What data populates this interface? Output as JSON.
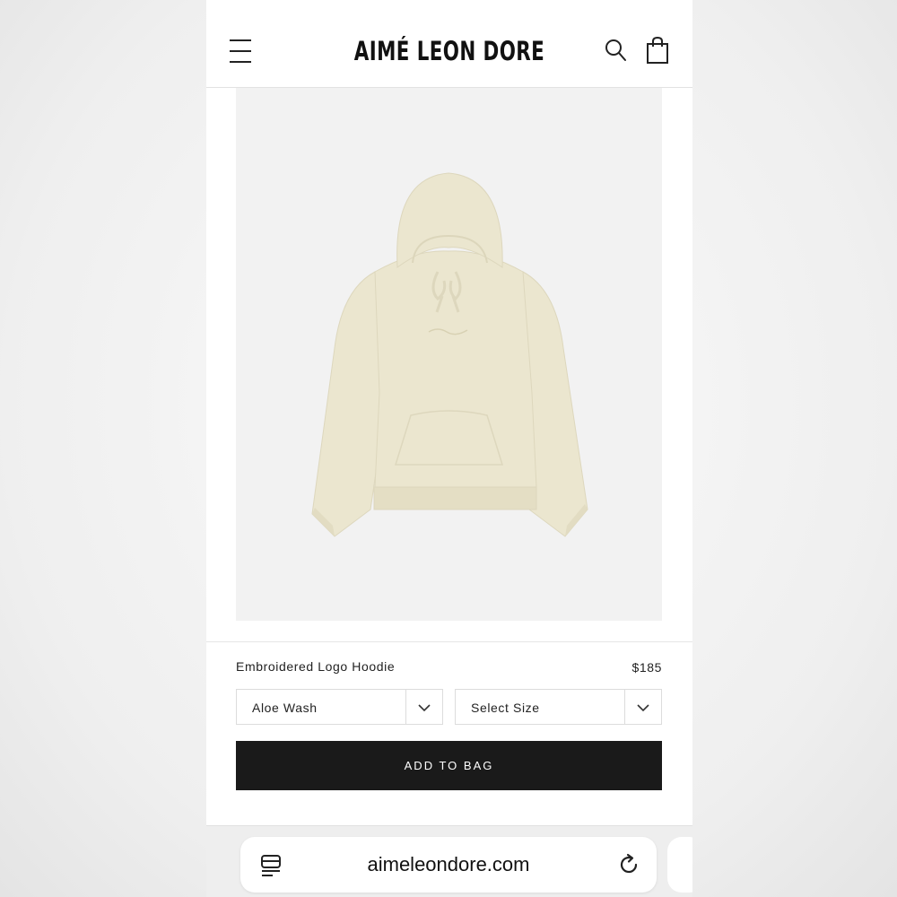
{
  "header": {
    "brand": "AIMÉ LEON DORE"
  },
  "product": {
    "name": "Embroidered Logo Hoodie",
    "price": "$185",
    "image_icon": "hoodie-image",
    "hoodie_color": "#ebe6cf"
  },
  "options": {
    "color_selected": "Aloe Wash",
    "size_selected": "Select Size"
  },
  "actions": {
    "add_to_bag": "ADD TO BAG"
  },
  "browser": {
    "url": "aimeleondore.com"
  },
  "icons": {
    "menu": "menu-icon",
    "search": "search-icon",
    "bag": "shopping-bag-icon",
    "chevron": "chevron-down-icon",
    "tabs": "tab-overview-icon",
    "reload": "reload-icon"
  },
  "colors": {
    "button_bg": "#1a1a1a",
    "image_bg": "#f2f2f2"
  }
}
